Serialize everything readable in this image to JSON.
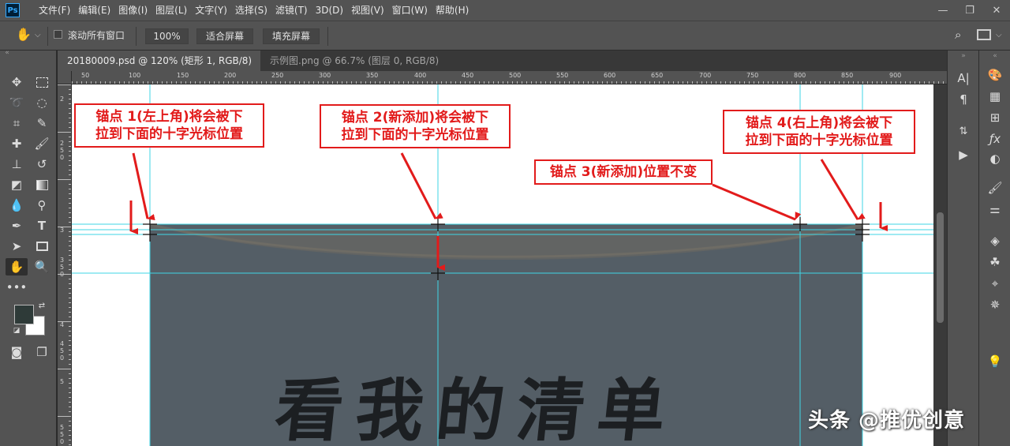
{
  "app": {
    "logo": "Ps"
  },
  "menu": [
    "文件(F)",
    "编辑(E)",
    "图像(I)",
    "图层(L)",
    "文字(Y)",
    "选择(S)",
    "滤镜(T)",
    "3D(D)",
    "视图(V)",
    "窗口(W)",
    "帮助(H)"
  ],
  "window_controls": {
    "minimize": "—",
    "restore": "❐",
    "close": "✕"
  },
  "options_bar": {
    "tool_icon": "hand-icon",
    "scroll_all_label": "滚动所有窗口",
    "scroll_all_checked": false,
    "zoom_btn": "100%",
    "fit_btn": "适合屏幕",
    "fill_btn": "填充屏幕"
  },
  "tabs": [
    {
      "label": "20180009.psd @ 120% (矩形 1, RGB/8) *",
      "close": "×",
      "active": true
    },
    {
      "label": "示例图.png @ 66.7% (图层 0, RGB/8) *",
      "close": "×",
      "active": false
    }
  ],
  "ruler_top_labels": [
    "50",
    "100",
    "150",
    "200",
    "250",
    "300",
    "350",
    "400",
    "450",
    "500",
    "550",
    "600",
    "650",
    "700",
    "750",
    "800",
    "850",
    "900"
  ],
  "ruler_left_labels": [
    "2",
    "2 5 0",
    "3",
    "3 5 0",
    "4",
    "4 5 0",
    "5",
    "5 5 0"
  ],
  "annotations": {
    "anchor1": [
      "锚点 1(左上角)将会被下",
      "拉到下面的十字光标位置"
    ],
    "anchor2": [
      "锚点 2(新添加)将会被下",
      "拉到下面的十字光标位置"
    ],
    "anchor3": [
      "锚点 3(新添加)位置不变"
    ],
    "anchor4": [
      "锚点 4(右上角)将会被下",
      "拉到下面的十字光标位置"
    ]
  },
  "canvas_text": "看我的清单",
  "watermark": "头条 @推优创意",
  "colors": {
    "annotation_red": "#e21b1b",
    "guide_cyan": "#3fd6e6",
    "shape_fill": "#545e66",
    "foreground_swatch": "#2e3a38",
    "background_swatch": "#ffffff"
  }
}
